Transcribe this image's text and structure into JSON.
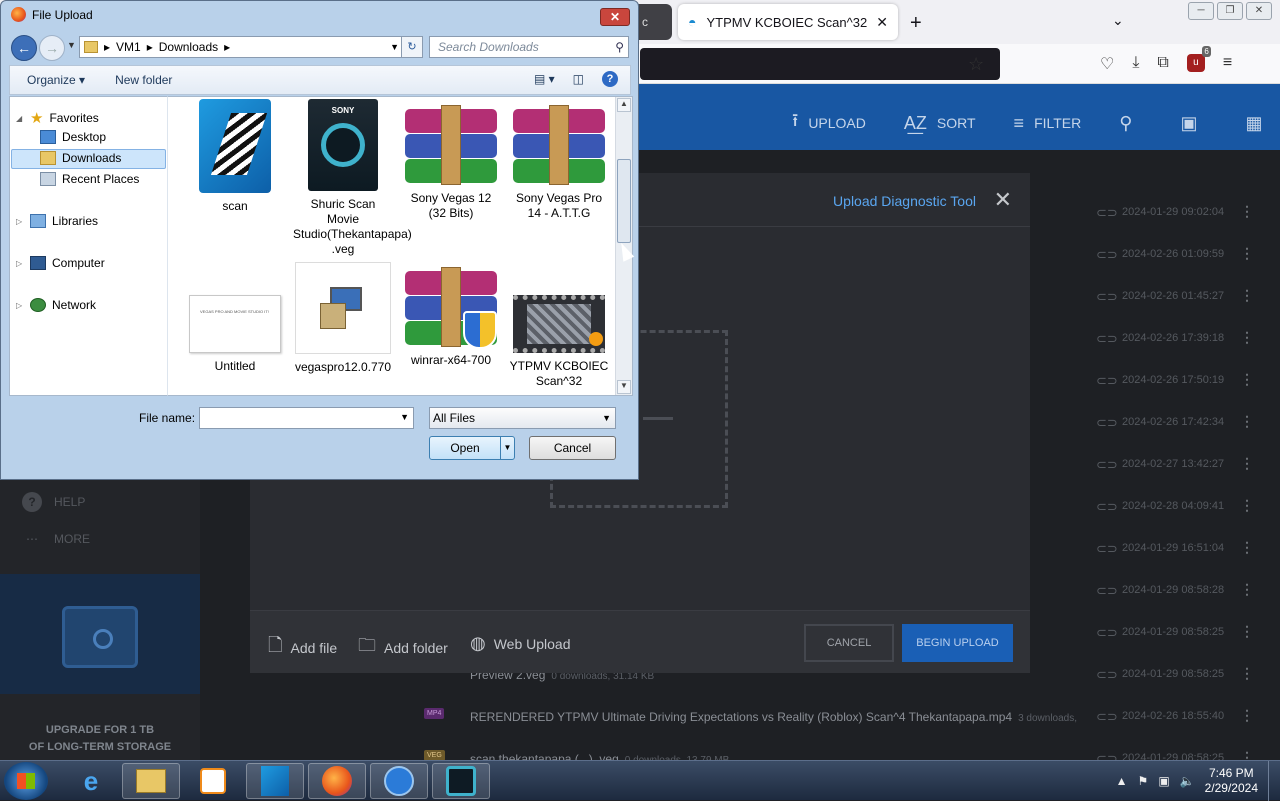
{
  "firefox": {
    "partial_tab_text": "c",
    "active_tab_title": "YTPMV KCBOIEC Scan^32",
    "new_tab_glyph": "+",
    "tab_list_glyph": "⌄"
  },
  "site": {
    "actions": [
      {
        "label": "UPLOAD",
        "icon": "upload-icon"
      },
      {
        "label": "SORT",
        "icon": "sort-az-icon"
      },
      {
        "label": "FILTER",
        "icon": "filter-icon"
      }
    ],
    "sidebar": {
      "help": "HELP",
      "more": "MORE",
      "upgrade_line1": "UPGRADE FOR 1 TB",
      "upgrade_line2": "OF LONG-TERM STORAGE"
    },
    "file_rows": [
      {
        "date": "2024-01-29 09:02:04"
      },
      {
        "date": "2024-02-26 01:09:59"
      },
      {
        "date": "2024-02-26 01:45:27"
      },
      {
        "date": "2024-02-26 17:39:18"
      },
      {
        "date": "2024-02-26 17:50:19"
      },
      {
        "date": "2024-02-26 17:42:34"
      },
      {
        "date": "2024-02-27 13:42:27"
      },
      {
        "date": "2024-02-28 04:09:41"
      },
      {
        "date": "2024-01-29 16:51:04"
      },
      {
        "date": "2024-01-29 08:58:28"
      },
      {
        "date": "2024-01-29 08:58:25"
      },
      {
        "name": "Preview 2.veg",
        "meta": "0 downloads, 31.14 KB",
        "date": "2024-01-29 08:58:25"
      },
      {
        "type": "MP4",
        "name": "RERENDERED YTPMV Ultimate Driving Expectations vs Reality (Roblox) Scan^4 Thekantapapa.mp4",
        "meta": "3 downloads,",
        "date": "2024-02-26 18:55:40"
      },
      {
        "type": "VEG",
        "name": "scan thekantapapa (_.) .veg",
        "meta": "0 downloads, 13.79 MB",
        "date": "2024-01-29 08:58:25"
      }
    ]
  },
  "upload_modal": {
    "title": "Upload Diagnostic Tool",
    "close_glyph": "✕",
    "add_file": "Add file",
    "add_folder": "Add folder",
    "web_upload": "Web Upload",
    "cancel": "CANCEL",
    "begin_upload": "BEGIN UPLOAD"
  },
  "dialog": {
    "title": "File Upload",
    "close_glyph": "✕",
    "breadcrumb": [
      "VM1",
      "Downloads"
    ],
    "search_placeholder": "Search Downloads",
    "toolbar": {
      "organize": "Organize ▾",
      "new_folder": "New folder"
    },
    "nav": {
      "favorites": "Favorites",
      "desktop": "Desktop",
      "downloads": "Downloads",
      "recent_places": "Recent Places",
      "libraries": "Libraries",
      "computer": "Computer",
      "network": "Network"
    },
    "files": [
      {
        "name": "scan"
      },
      {
        "name": "Shuric Scan Movie Studio(Thekantapapa) .veg",
        "brand": "SONY"
      },
      {
        "name": "Sony Vegas 12 (32 Bits)"
      },
      {
        "name": "Sony Vegas Pro 14 - A.T.T.G"
      },
      {
        "name": "Untitled",
        "thumb_text": "VEGAS PRO AND MOVIE STUDIO IT!"
      },
      {
        "name": "vegaspro12.0.770"
      },
      {
        "name": "winrar-x64-700"
      },
      {
        "name": "YTPMV KCBOIEC Scan^32"
      }
    ],
    "file_name_label": "File name:",
    "file_name_value": "",
    "filter_value": "All Files",
    "open_label": "Open",
    "cancel_label": "Cancel"
  },
  "taskbar": {
    "time": "7:46 PM",
    "date": "2/29/2024"
  }
}
